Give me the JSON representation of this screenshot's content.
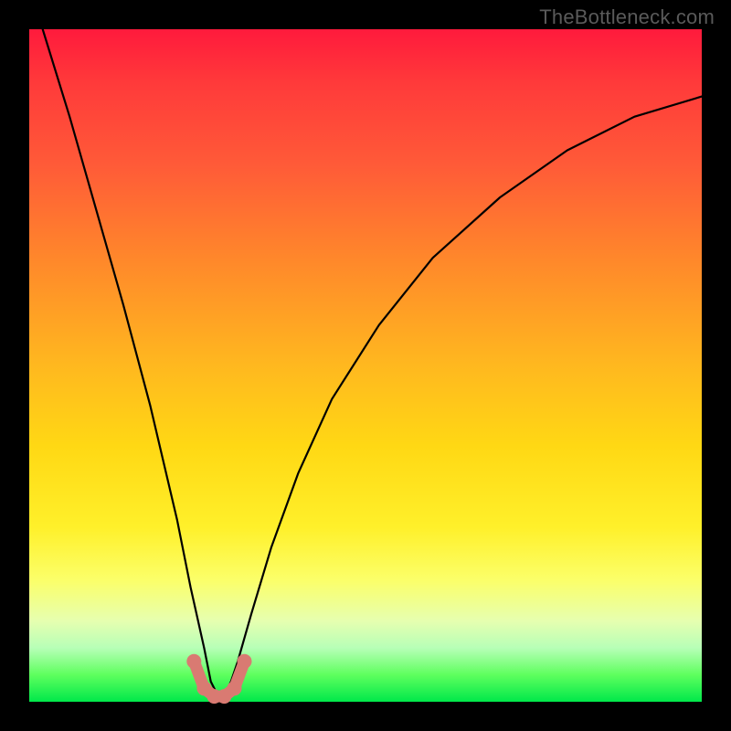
{
  "watermark": "TheBottleneck.com",
  "chart_data": {
    "type": "line",
    "title": "",
    "xlabel": "",
    "ylabel": "",
    "xlim": [
      0,
      100
    ],
    "ylim": [
      0,
      100
    ],
    "grid": false,
    "legend": null,
    "series": [
      {
        "name": "bottleneck-curve",
        "x": [
          2,
          6,
          10,
          14,
          18,
          22,
          24,
          26,
          27,
          28,
          29,
          30,
          31,
          33,
          36,
          40,
          45,
          52,
          60,
          70,
          80,
          90,
          100
        ],
        "y": [
          100,
          87,
          73,
          59,
          44,
          27,
          17,
          8,
          3,
          1,
          1,
          3,
          6,
          13,
          23,
          34,
          45,
          56,
          66,
          75,
          82,
          87,
          90
        ]
      }
    ],
    "markers": {
      "name": "valley-highlight",
      "color": "#d97a72",
      "points_x": [
        24.5,
        26,
        27.5,
        29,
        30.5,
        32
      ],
      "points_y": [
        6,
        2,
        0.8,
        0.8,
        2,
        6
      ]
    },
    "background_gradient": {
      "orientation": "vertical",
      "stops": [
        {
          "pos": 0.0,
          "color": "#ff1a3c"
        },
        {
          "pos": 0.35,
          "color": "#ff8a2a"
        },
        {
          "pos": 0.62,
          "color": "#ffd814"
        },
        {
          "pos": 0.82,
          "color": "#fbff6a"
        },
        {
          "pos": 0.92,
          "color": "#b7ffb7"
        },
        {
          "pos": 1.0,
          "color": "#00e84a"
        }
      ]
    }
  }
}
